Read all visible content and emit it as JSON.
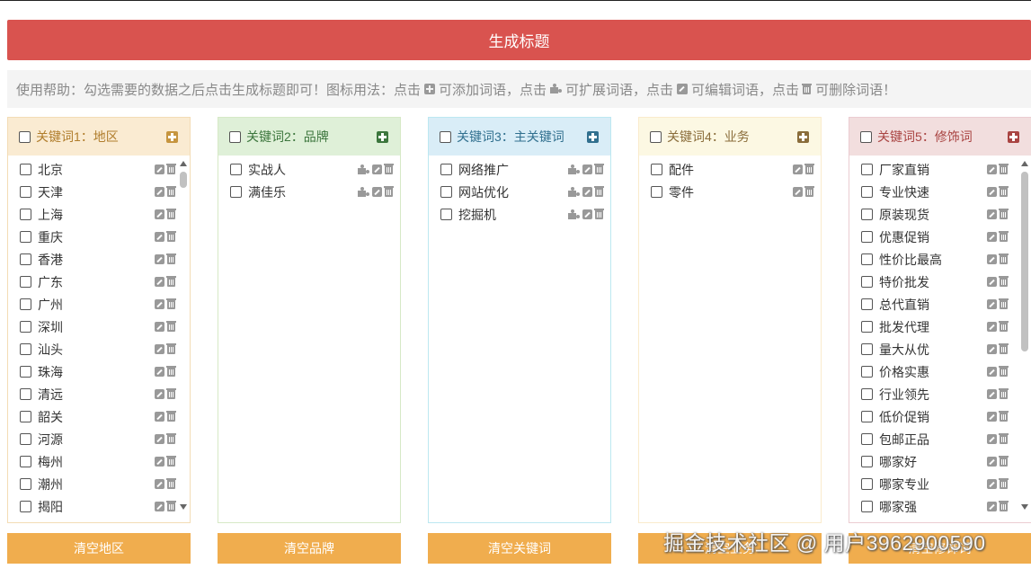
{
  "generate_button": "生成标题",
  "help": {
    "p1": "使用帮助：勾选需要的数据之后点击生成标题即可！图标用法：点击",
    "p2": "可添加词语，点击",
    "p3": "可扩展词语，点击",
    "p4": "可编辑词语，点击",
    "p5": "可删除词语！"
  },
  "panels": [
    {
      "title": "关键词1：地区",
      "clear": "清空地区",
      "color": "#b07d2c",
      "items": [
        "北京",
        "天津",
        "上海",
        "重庆",
        "香港",
        "广东",
        "广州",
        "深圳",
        "汕头",
        "珠海",
        "清远",
        "韶关",
        "河源",
        "梅州",
        "潮州",
        "揭阳"
      ]
    },
    {
      "title": "关键词2：品牌",
      "clear": "清空品牌",
      "color": "#3c763d",
      "items": [
        "实战人",
        "满佳乐"
      ]
    },
    {
      "title": "关键词3：主关键词",
      "clear": "清空关键词",
      "color": "#31708f",
      "items": [
        "网络推广",
        "网站优化",
        "挖掘机"
      ]
    },
    {
      "title": "关键词4：业务",
      "clear": "清空业务",
      "color": "#8a6d3b",
      "items": [
        "配件",
        "零件"
      ]
    },
    {
      "title": "关键词5：修饰词",
      "clear": "清空修饰词",
      "color": "#a94442",
      "items": [
        "厂家直销",
        "专业快速",
        "原装现货",
        "优惠促销",
        "性价比最高",
        "特价批发",
        "总代直销",
        "批发代理",
        "量大从优",
        "价格实惠",
        "行业领先",
        "低价促销",
        "包邮正品",
        "哪家好",
        "哪家专业",
        "哪家强"
      ]
    }
  ],
  "watermark": "掘金技术社区 @ 用户3962900590"
}
